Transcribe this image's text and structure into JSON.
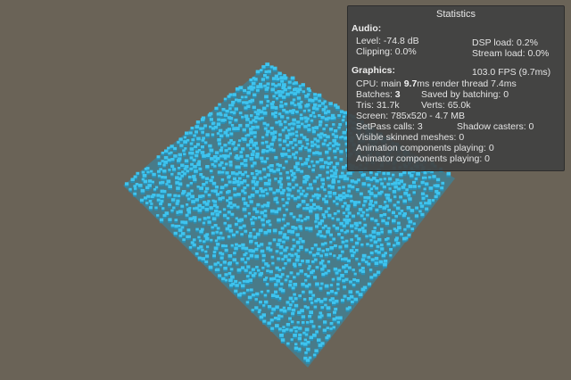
{
  "window": {
    "background": "#6a6357"
  },
  "scene": {
    "object": "cube-grid",
    "cube_color": "#3ec4ef",
    "cube_shadow_color": "#2b8fb3"
  },
  "stats": {
    "title": "Statistics",
    "audio": {
      "heading": "Audio:",
      "level": "Level: -74.8 dB",
      "dsp_load": "DSP load: 0.2%",
      "clipping": "Clipping: 0.0%",
      "stream_load": "Stream load: 0.0%"
    },
    "graphics": {
      "heading": "Graphics:",
      "fps": "103.0 FPS (9.7ms)",
      "cpu_prefix": "CPU: main ",
      "cpu_main_value": "9.7",
      "cpu_suffix": "ms  render thread 7.4ms",
      "batches_prefix": "Batches: ",
      "batches_value": "3",
      "saved_by_batching": "Saved by batching: 0",
      "tris": "Tris: 31.7k",
      "verts": "Verts: 65.0k",
      "screen": "Screen: 785x520 - 4.7 MB",
      "setpass": "SetPass calls: 3",
      "shadow_casters": "Shadow casters: 0",
      "skinned_meshes": "Visible skinned meshes: 0",
      "animation_components": "Animation components playing: 0",
      "animator_components": "Animator components playing: 0"
    }
  }
}
